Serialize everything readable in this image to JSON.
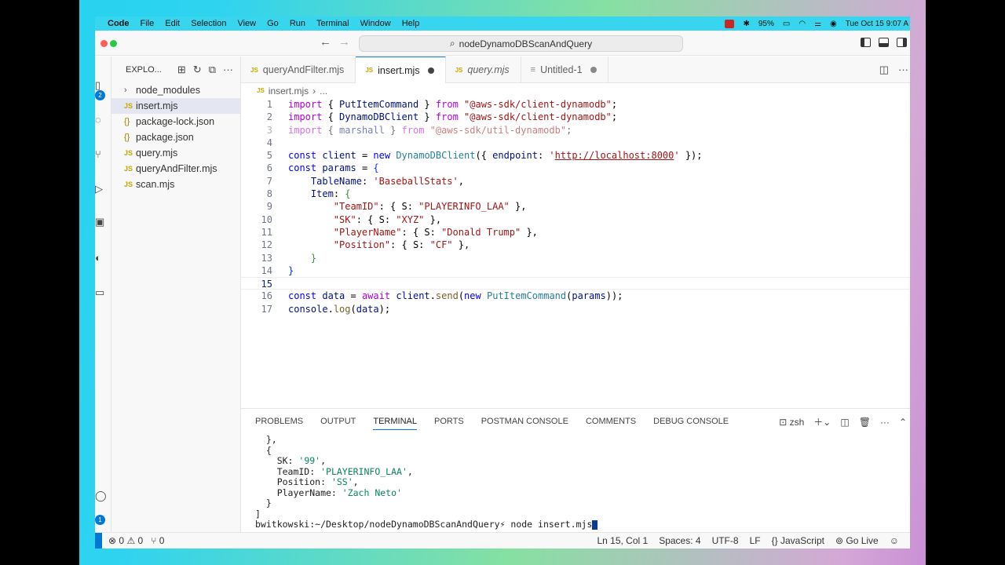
{
  "menubar": {
    "app": "Code",
    "items": [
      "File",
      "Edit",
      "Selection",
      "View",
      "Go",
      "Run",
      "Terminal",
      "Window",
      "Help"
    ],
    "battery": "95%",
    "datetime": "Tue Oct 15  9:07 A"
  },
  "titlebar": {
    "search_text": "nodeDynamoDBScanAndQuery"
  },
  "activity": {
    "scm_badge": "2",
    "accounts_badge": "1"
  },
  "sidebar": {
    "title": "EXPLO...",
    "items": [
      {
        "label": "node_modules",
        "kind": "folder"
      },
      {
        "label": "insert.mjs",
        "kind": "js"
      },
      {
        "label": "package-lock.json",
        "kind": "json"
      },
      {
        "label": "package.json",
        "kind": "json"
      },
      {
        "label": "query.mjs",
        "kind": "js"
      },
      {
        "label": "queryAndFilter.mjs",
        "kind": "js"
      },
      {
        "label": "scan.mjs",
        "kind": "js"
      }
    ]
  },
  "editor": {
    "tabs": [
      {
        "label": "queryAndFilter.mjs",
        "icon": "JS"
      },
      {
        "label": "insert.mjs",
        "icon": "JS"
      },
      {
        "label": "query.mjs",
        "icon": "JS"
      },
      {
        "label": "Untitled-1",
        "icon": "≡"
      }
    ],
    "breadcrumb": {
      "icon": "JS",
      "file": "insert.mjs",
      "sep": "›",
      "rest": "..."
    },
    "line_numbers": [
      "1",
      "2",
      "3",
      "4",
      "5",
      "6",
      "7",
      "8",
      "9",
      "10",
      "11",
      "12",
      "13",
      "14",
      "15",
      "16",
      "17"
    ],
    "code": {
      "l1": {
        "kw": "import",
        "a": " { ",
        "name": "PutItemCommand",
        "b": " } ",
        "from": "from",
        "sp": " ",
        "mod": "\"@aws-sdk/client-dynamodb\"",
        "end": ";"
      },
      "l2": {
        "kw": "import",
        "a": " { ",
        "name": "DynamoDBClient",
        "b": " } ",
        "from": "from",
        "sp": " ",
        "mod": "\"@aws-sdk/client-dynamodb\"",
        "end": ";"
      },
      "l3": {
        "kw": "import",
        "a": " { ",
        "name": "marshall",
        "b": " } ",
        "from": "from",
        "sp": " ",
        "mod": "\"@aws-sdk/util-dynamodb\"",
        "end": ";"
      },
      "l5": {
        "const": "const",
        "sp1": " ",
        "var": "client",
        "eq": " = ",
        "new": "new",
        "sp2": " ",
        "cls": "DynamoDBClient",
        "open": "({ ",
        "key": "endpoint",
        "colon": ": ",
        "q1": "'",
        "url": "http://localhost:8000",
        "q2": "'",
        "close": " });"
      },
      "l6": {
        "const": "const",
        "sp1": " ",
        "var": "params",
        "eq": " = ",
        "open": "{"
      },
      "l7": {
        "indent": "    ",
        "key": "TableName",
        "colon": ": ",
        "val": "'BaseballStats'",
        "end": ","
      },
      "l8": {
        "indent": "    ",
        "key": "Item",
        "colon": ": ",
        "open": "{"
      },
      "l9": {
        "indent": "        ",
        "key": "\"TeamID\"",
        "mid": ": { S: ",
        "val": "\"PLAYERINFO_LAA\"",
        "end": " },"
      },
      "l10": {
        "indent": "        ",
        "key": "\"SK\"",
        "mid": ": { S: ",
        "val": "\"XYZ\"",
        "end": " },"
      },
      "l11": {
        "indent": "        ",
        "key": "\"PlayerName\"",
        "mid": ": { S: ",
        "val": "\"Donald Trump\"",
        "end": " },"
      },
      "l12": {
        "indent": "        ",
        "key": "\"Position\"",
        "mid": ": { S: ",
        "val": "\"CF\"",
        "end": " },"
      },
      "l13": {
        "indent": "    ",
        "close": "}"
      },
      "l14": {
        "close": "}"
      },
      "l16": {
        "const": "const",
        "sp1": " ",
        "var": "data",
        "eq": " = ",
        "await": "await",
        "sp2": " ",
        "obj": "client",
        "dot": ".",
        "fn": "send",
        "open": "(",
        "new": "new",
        "sp3": " ",
        "cls": "PutItemCommand",
        "open2": "(",
        "arg": "params",
        "close": "));"
      },
      "l17": {
        "obj": "console",
        "dot": ".",
        "fn": "log",
        "open": "(",
        "arg": "data",
        "close": ");"
      }
    }
  },
  "panel": {
    "tabs": [
      "PROBLEMS",
      "OUTPUT",
      "TERMINAL",
      "PORTS",
      "POSTMAN CONSOLE",
      "COMMENTS",
      "DEBUG CONSOLE"
    ],
    "shell": "zsh",
    "terminal": {
      "t1": "  },",
      "t2": "  {",
      "t3k": "    SK: ",
      "t3v": "'99'",
      "t3e": ",",
      "t4k": "    TeamID: ",
      "t4v": "'PLAYERINFO_LAA'",
      "t4e": ",",
      "t5k": "    Position: ",
      "t5v": "'SS'",
      "t5e": ",",
      "t6k": "    PlayerName: ",
      "t6v": "'Zach Neto'",
      "t7": "  }",
      "t8": "]",
      "prompt": "bwitkowski:~/Desktop/nodeDynamoDBScanAndQuery⚡ node insert.mjs"
    }
  },
  "statusbar": {
    "errors": "0",
    "warnings": "0",
    "ports": "0",
    "position": "Ln 15, Col 1",
    "spaces": "Spaces: 4",
    "encoding": "UTF-8",
    "eol": "LF",
    "language": "JavaScript",
    "golive": "Go Live"
  }
}
